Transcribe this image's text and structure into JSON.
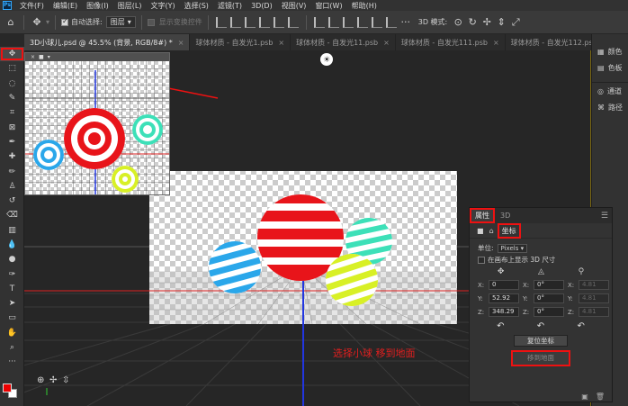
{
  "menubar": {
    "logo": "Ps",
    "items": [
      "文件(F)",
      "编辑(E)",
      "图像(I)",
      "图层(L)",
      "文字(Y)",
      "选择(S)",
      "滤镜(T)",
      "3D(D)",
      "视图(V)",
      "窗口(W)",
      "帮助(H)"
    ]
  },
  "options": {
    "auto_select_label": "自动选择:",
    "auto_select_value": "图层",
    "show_transform_label": "显示变换控件",
    "mode_label": "3D 模式:"
  },
  "tabs": [
    {
      "label": "3D小球儿.psd @ 45.5% (背景, RGB/8#) *",
      "active": true
    },
    {
      "label": "球体材质 - 自发光1.psb",
      "active": false
    },
    {
      "label": "球体材质 - 自发光11.psb",
      "active": false
    },
    {
      "label": "球体材质 - 自发光111.psb",
      "active": false
    },
    {
      "label": "球体材质 - 自发光112.psb",
      "active": false
    }
  ],
  "dock": {
    "items": [
      "颜色",
      "色板",
      "通道",
      "路径"
    ]
  },
  "props_panel": {
    "tab_properties": "属性",
    "tab_3d": "3D",
    "coord_label": "坐标",
    "unit_label": "单位:",
    "unit_value": "Pixels",
    "show_on_canvas": "在画布上显示 3D 尺寸",
    "pos": {
      "x": "0",
      "y": "52.92",
      "z": "348.29"
    },
    "rot": {
      "x": "0°",
      "y": "0°",
      "z": "0°"
    },
    "scale": {
      "x": "4.81",
      "y": "4.81",
      "z": "4.81"
    },
    "reset_btn": "复位坐标",
    "move_ground_btn": "移到地面"
  },
  "annotation": "选择小球 移到地面",
  "colors": {
    "ball_red": "#e8141a",
    "ball_blue": "#2aa7ea",
    "ball_teal": "#3de0b8",
    "ball_yellow": "#d8f026",
    "annot_red": "#e21f1f",
    "ps_blue": "#31a8ff"
  }
}
